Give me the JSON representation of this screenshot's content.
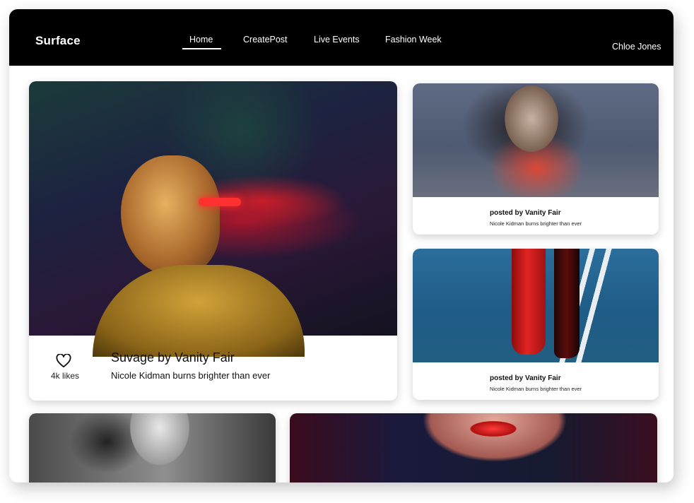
{
  "app": {
    "brand": "Surface",
    "user": "Chloe Jones"
  },
  "nav": {
    "items": [
      {
        "label": "Home",
        "active": true
      },
      {
        "label": "CreatePost",
        "active": false
      },
      {
        "label": "Live Events",
        "active": false
      },
      {
        "label": "Fashion Week",
        "active": false
      }
    ]
  },
  "feature": {
    "likes": "4k likes",
    "title": "Suvage by Vanity Fair",
    "subtitle": "Nicole Kidman burns brighter than ever",
    "icon": "heart-icon"
  },
  "side_posts": [
    {
      "posted_by": "posted by Vanity Fair",
      "subtitle": "Nicole Kidman burns brighter than ever"
    },
    {
      "posted_by": "posted by Vanity Fair",
      "subtitle": "Nicole Kidman burns brighter than ever"
    }
  ],
  "colors": {
    "topbar": "#000000",
    "background": "#ffffff",
    "text": "#111111"
  }
}
